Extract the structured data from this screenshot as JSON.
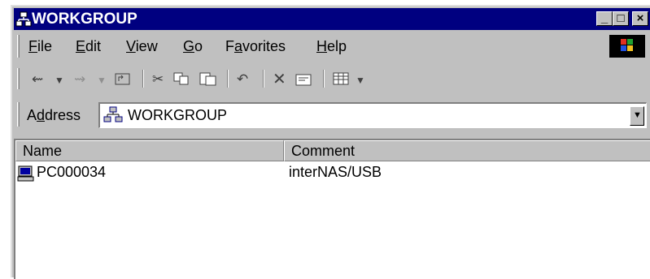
{
  "window": {
    "title": "WORKGROUP",
    "controls": [
      "_",
      "□",
      "×"
    ]
  },
  "menu": [
    {
      "label": "File",
      "accel": "F"
    },
    {
      "label": "Edit",
      "accel": "E"
    },
    {
      "label": "View",
      "accel": "V"
    },
    {
      "label": "Go",
      "accel": "G"
    },
    {
      "label": "Favorites",
      "accel": "a"
    },
    {
      "label": "Help",
      "accel": "H"
    }
  ],
  "toolbar": {
    "icons": [
      "back-arrow-icon",
      "dropdown-icon",
      "forward-arrow-icon",
      "dropdown-icon",
      "up-folder-icon",
      "cut-icon",
      "copy-icon",
      "paste-icon",
      "undo-icon",
      "delete-icon",
      "properties-icon",
      "views-icon",
      "dropdown-icon"
    ]
  },
  "address": {
    "label": "Address",
    "accel": "d",
    "value": "WORKGROUP"
  },
  "list": {
    "columns": [
      "Name",
      "Comment"
    ],
    "rows": [
      {
        "name": "PC000034",
        "comment": "interNAS/USB"
      }
    ]
  },
  "colors": {
    "title_bg": "#000080",
    "face": "#c0c0c0"
  }
}
